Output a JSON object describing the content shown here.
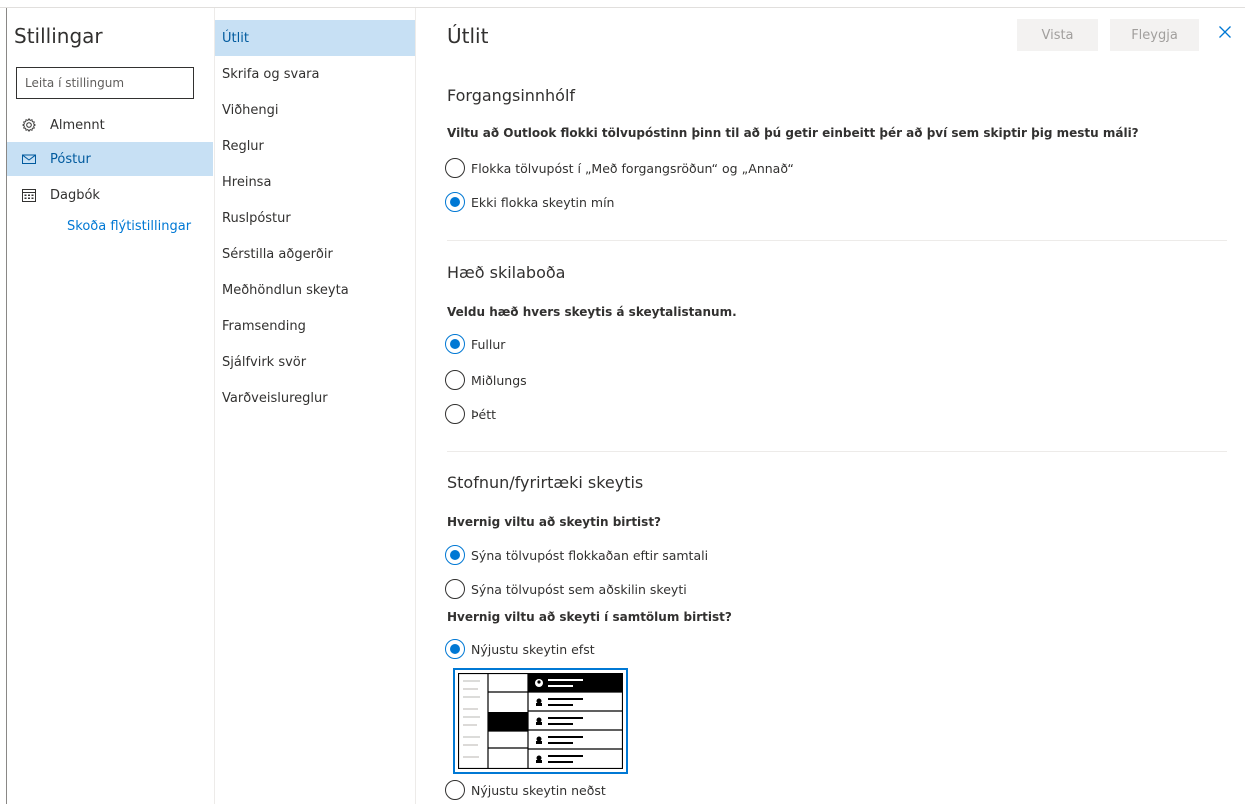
{
  "left": {
    "title": "Stillingar",
    "search_placeholder": "Leita í stillingum",
    "items": [
      {
        "label": "Almennt",
        "icon": "gear-icon",
        "active": false
      },
      {
        "label": "Póstur",
        "icon": "mail-icon",
        "active": true
      },
      {
        "label": "Dagbók",
        "icon": "calendar-icon",
        "active": false
      }
    ],
    "quick_settings_link": "Skoða flýtistillingar"
  },
  "sub": {
    "items": [
      "Útlit",
      "Skrifa og svara",
      "Viðhengi",
      "Reglur",
      "Hreinsa",
      "Ruslpóstur",
      "Sérstilla aðgerðir",
      "Meðhöndlun skeyta",
      "Framsending",
      "Sjálfvirk svör",
      "Varðveislureglur"
    ],
    "active_index": 0
  },
  "main": {
    "title": "Útlit",
    "save_label": "Vista",
    "discard_label": "Fleygja",
    "focused": {
      "title": "Forgangsinnhólf",
      "question": "Viltu að Outlook flokki tölvupóstinn þinn til að þú getir einbeitt þér að því sem skiptir þig mestu máli?",
      "options": [
        "Flokka tölvupóst í „Með forgangsröðun“ og „Annað“",
        "Ekki flokka skeytin mín"
      ],
      "selected": 1
    },
    "height": {
      "title": "Hæð skilaboða",
      "question": "Veldu hæð hvers skeytis á skeytalistanum.",
      "options": [
        "Fullur",
        "Miðlungs",
        "Þétt"
      ],
      "selected": 0
    },
    "org": {
      "title": "Stofnun/fyrirtæki skeytis",
      "question1": "Hvernig viltu að skeytin birtist?",
      "options1": [
        "Sýna tölvupóst flokkaðan eftir samtali",
        "Sýna tölvupóst sem aðskilin skeyti"
      ],
      "selected1": 0,
      "question2": "Hvernig viltu að skeyti í samtölum birtist?",
      "options2": [
        "Nýjustu skeytin efst",
        "Nýjustu skeytin neðst"
      ],
      "selected2": 0
    }
  },
  "colors": {
    "accent": "#0078d4",
    "selected_bg": "#c7e0f4",
    "selected_text": "#005a9e"
  }
}
